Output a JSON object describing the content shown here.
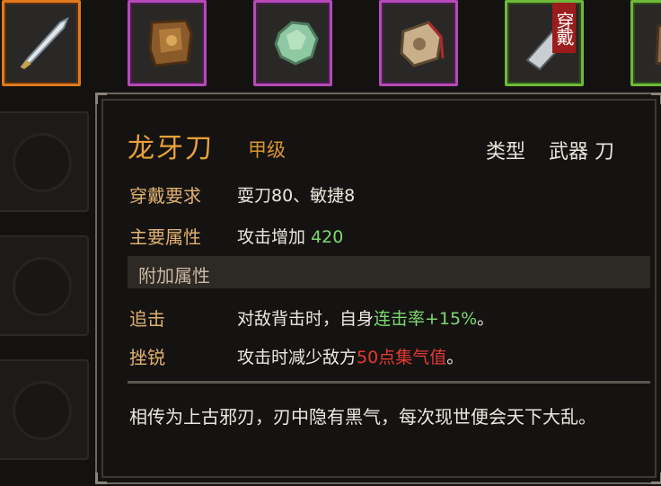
{
  "inventory": {
    "slots": [
      {
        "icon": "dragon-fang-blade-icon",
        "rarity": "orange"
      },
      {
        "icon": "leather-armor-icon",
        "rarity": "purple"
      },
      {
        "icon": "jade-stone-icon",
        "rarity": "purple"
      },
      {
        "icon": "pouch-icon",
        "rarity": "purple"
      },
      {
        "icon": "cleaver-icon",
        "rarity": "green",
        "tag": "穿戴"
      },
      {
        "icon": "partial-item-icon",
        "rarity": "green"
      }
    ]
  },
  "tooltip": {
    "name": "龙牙刀",
    "grade": "甲级",
    "type_label": "类型",
    "type_value": "武器 刀",
    "requirement_label": "穿戴要求",
    "requirement_value": "耍刀80、敏捷8",
    "main_attr_label": "主要属性",
    "main_attr_text": "攻击增加",
    "main_attr_value": "420",
    "extra_attr_header": "附加属性",
    "extra_attrs": [
      {
        "label": "追击",
        "prefix": "对敌背击时，自身",
        "highlight": "连击率+15%",
        "suffix": "。"
      },
      {
        "label": "挫锐",
        "prefix": "攻击时减少敌方",
        "highlight": "50点集气值",
        "suffix": "。"
      }
    ],
    "description": "相传为上古邪刃，刃中隐有黑气，每次现世便会天下大乱。"
  },
  "colors": {
    "name": "#e8a03a",
    "label": "#e0b070",
    "green_value": "#7dd870",
    "red_value": "#e23a32",
    "orange_rarity": "#e07a1c",
    "purple_rarity": "#b54ab8",
    "green_rarity": "#6fb83a",
    "worn_tag": "#9c1c1c"
  }
}
